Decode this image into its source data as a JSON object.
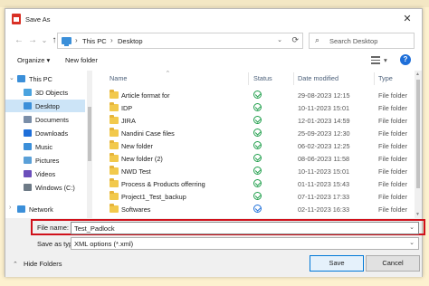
{
  "window": {
    "title": "Save As",
    "close_glyph": "✕"
  },
  "nav": {
    "back_glyph": "←",
    "forward_glyph": "→",
    "dropdown_glyph": "⌄",
    "up_glyph": "↑",
    "breadcrumb": [
      "This PC",
      "Desktop"
    ],
    "breadcrumb_sep": "›",
    "search_placeholder": "Search Desktop"
  },
  "toolbar": {
    "organize_label": "Organize ▾",
    "new_folder_label": "New folder",
    "view_caret": "▾",
    "help_glyph": "?"
  },
  "sidebar": {
    "items": [
      {
        "label": "This PC",
        "icon": "pc-icon",
        "color": "#3b8fd9",
        "expanded": true
      },
      {
        "label": "3D Objects",
        "icon": "cube-icon",
        "color": "#4aa3df"
      },
      {
        "label": "Desktop",
        "icon": "desktop-icon",
        "color": "#3b8fd9",
        "selected": true
      },
      {
        "label": "Documents",
        "icon": "documents-icon",
        "color": "#7a8ea8"
      },
      {
        "label": "Downloads",
        "icon": "downloads-icon",
        "color": "#1e6fd9"
      },
      {
        "label": "Music",
        "icon": "music-icon",
        "color": "#3b8fd9"
      },
      {
        "label": "Pictures",
        "icon": "pictures-icon",
        "color": "#5aa0d8"
      },
      {
        "label": "Videos",
        "icon": "videos-icon",
        "color": "#6b4fbb"
      },
      {
        "label": "Windows (C:)",
        "icon": "drive-icon",
        "color": "#6d7a86"
      },
      {
        "label": "Network",
        "icon": "network-icon",
        "color": "#3b8fd9"
      }
    ]
  },
  "file_list": {
    "columns": {
      "name": "Name",
      "status": "Status",
      "date": "Date modified",
      "type": "Type"
    },
    "rows": [
      {
        "name": "Article format for",
        "status": "synced",
        "date": "29-08-2023 12:15",
        "type": "File folder"
      },
      {
        "name": "IDP",
        "status": "synced",
        "date": "10-11-2023 15:01",
        "type": "File folder"
      },
      {
        "name": "JIRA",
        "status": "synced",
        "date": "12-01-2023 14:59",
        "type": "File folder"
      },
      {
        "name": "Nandini Case files",
        "status": "synced",
        "date": "25-09-2023 12:30",
        "type": "File folder"
      },
      {
        "name": "New folder",
        "status": "synced",
        "date": "06-02-2023 12:25",
        "type": "File folder"
      },
      {
        "name": "New folder (2)",
        "status": "synced",
        "date": "08-06-2023 11:58",
        "type": "File folder"
      },
      {
        "name": "NWD Test",
        "status": "synced",
        "date": "10-11-2023 15:01",
        "type": "File folder"
      },
      {
        "name": "Process & Products offerring",
        "status": "synced",
        "date": "01-11-2023 15:43",
        "type": "File folder"
      },
      {
        "name": "Project1_Test_backup",
        "status": "synced",
        "date": "07-11-2023 17:33",
        "type": "File folder"
      },
      {
        "name": "Softwares",
        "status": "syncing",
        "date": "02-11-2023 16:33",
        "type": "File folder"
      }
    ]
  },
  "fields": {
    "file_name_label": "File name:",
    "file_name_value": "Test_Padlock",
    "save_type_label": "Save as type:",
    "save_type_value": "XML options (*.xml)",
    "dropdown_glyph": "⌄"
  },
  "footer": {
    "hide_folders_label": "Hide Folders",
    "chevron": "⌃",
    "save_label": "Save",
    "cancel_label": "Cancel"
  },
  "colors": {
    "highlight_border": "#d0111b",
    "selection": "#cce4f7",
    "folder": "#f2c94c",
    "accent": "#0078d7"
  }
}
